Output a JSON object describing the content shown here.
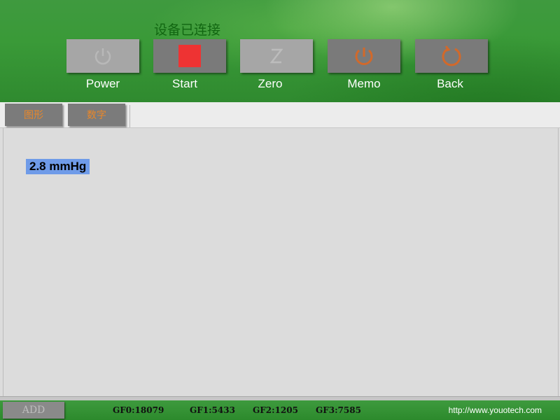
{
  "status": {
    "connection_text": "设备已连接"
  },
  "toolbar": {
    "buttons": [
      {
        "label": "Power",
        "icon": "power-icon",
        "state": "disabled"
      },
      {
        "label": "Start",
        "icon": "start-stop-square-icon",
        "state": "enabled"
      },
      {
        "label": "Zero",
        "icon": "zero-z-icon",
        "state": "disabled"
      },
      {
        "label": "Memo",
        "icon": "memo-power-icon",
        "state": "enabled"
      },
      {
        "label": "Back",
        "icon": "back-refresh-icon",
        "state": "enabled"
      }
    ]
  },
  "tabs": [
    {
      "label": "图形"
    },
    {
      "label": "数字"
    }
  ],
  "main": {
    "reading": "2.8 mmHg"
  },
  "footer": {
    "add_label": "ADD",
    "gf0": "GF0:18079",
    "gf1": "GF1:5433",
    "gf2": "GF2:1205",
    "gf3": "GF3:7585",
    "url": "http://www.youotech.com"
  },
  "colors": {
    "header_green": "#3a9a38",
    "connection_text": "#116611",
    "button_gray": "#7a7a7a",
    "button_disabled": "#a6a6a6",
    "start_red": "#ee3333",
    "icon_orange": "#d2692a",
    "tab_text_orange": "#e8872a",
    "reading_highlight": "#6f9be8"
  }
}
